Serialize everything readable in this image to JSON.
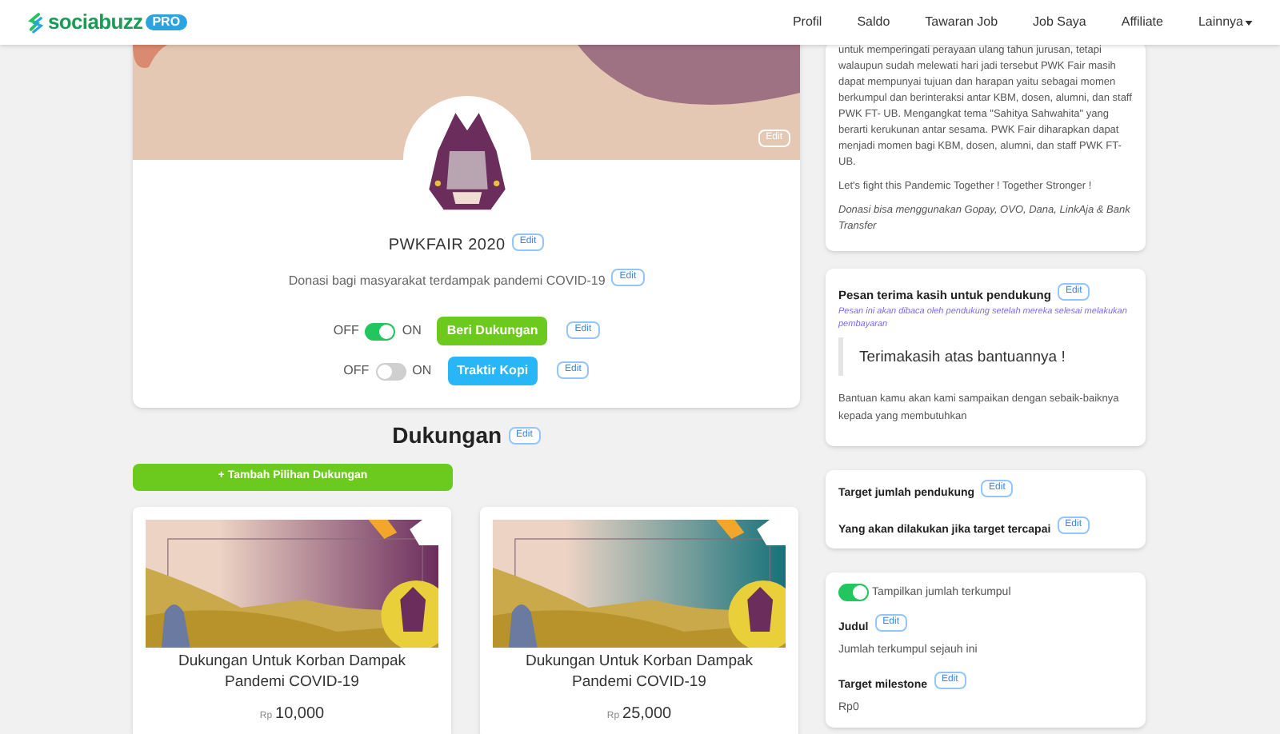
{
  "nav": {
    "brand": "sociabuzz",
    "badge": "PRO",
    "links": [
      {
        "label": "Profil",
        "kind": "link"
      },
      {
        "label": "Saldo",
        "kind": "link"
      },
      {
        "label": "Tawaran Job",
        "kind": "link"
      },
      {
        "label": "Job Saya",
        "kind": "link"
      },
      {
        "label": "Affiliate",
        "kind": "link"
      },
      {
        "label": "Lainnya",
        "kind": "dropdown"
      }
    ]
  },
  "profile": {
    "banner_edit": "Edit",
    "name": "PWKFAIR 2020",
    "name_edit": "Edit",
    "description": "Donasi bagi masyarakat terdampak pandemi COVID-19",
    "description_edit": "Edit",
    "toggles": [
      {
        "off_label": "OFF",
        "on_label": "ON",
        "on": true,
        "button": "Beri Dukungan",
        "color": "#6cc91e",
        "edit": "Edit"
      },
      {
        "off_label": "OFF",
        "on_label": "ON",
        "on": false,
        "button": "Traktir Kopi",
        "color": "#29b6f6",
        "edit": "Edit"
      }
    ]
  },
  "dukungan": {
    "title": "Dukungan",
    "edit": "Edit",
    "add_button": "+ Tambah Pilihan Dukungan",
    "items": [
      {
        "title": "Dukungan Untuk Korban Dampak Pandemi COVID-19",
        "currency": "Rp",
        "price": "10,000",
        "kind": "picture"
      },
      {
        "title": "Dukungan Untuk Korban Dampak Pandemi COVID-19",
        "currency": "Rp",
        "price": "25,000",
        "kind": "picture"
      }
    ]
  },
  "about": {
    "paragraphs": [
      {
        "kind": "text",
        "text": "untuk memperingati perayaan ulang tahun jurusan, tetapi walaupun sudah melewati hari jadi tersebut PWK Fair masih dapat mempunyai tujuan dan harapan yaitu sebagai momen berkumpul dan berinteraksi antar KBM, dosen, alumni, dan staff PWK FT- UB. Mengangkat tema \"Sahitya Sahwahita\" yang berarti kerukunan antar sesama. PWK Fair diharapkan dapat menjadi momen bagi KBM, dosen, alumni, dan staff PWK FT- UB."
      },
      {
        "kind": "text",
        "text": "Let's fight this Pandemic Together ! Together Stronger !"
      },
      {
        "kind": "italic",
        "text": "Donasi bisa menggunakan Gopay, OVO, Dana, LinkAja & Bank Transfer"
      }
    ]
  },
  "thanks": {
    "title": "Pesan terima kasih untuk pendukung",
    "edit": "Edit",
    "note": "Pesan ini akan dibaca oleh pendukung setelah mereka selesai melakukan pembayaran",
    "quote": "Terimakasih atas bantuannya !",
    "body": "Bantuan kamu akan kami sampaikan dengan sebaik-baiknya kepada yang  membutuhkan"
  },
  "target": {
    "rows": [
      {
        "label": "Target jumlah pendukung",
        "edit": "Edit"
      },
      {
        "label": "Yang akan dilakukan jika target tercapai",
        "edit": "Edit"
      }
    ]
  },
  "counter": {
    "toggle": {
      "label": "Tampilkan jumlah terkumpul",
      "on": true
    },
    "fields": [
      {
        "label": "Judul",
        "edit": "Edit",
        "value": "Jumlah terkumpul sejauh ini"
      },
      {
        "label": "Target milestone",
        "edit": "Edit",
        "value": "Rp0"
      }
    ]
  }
}
